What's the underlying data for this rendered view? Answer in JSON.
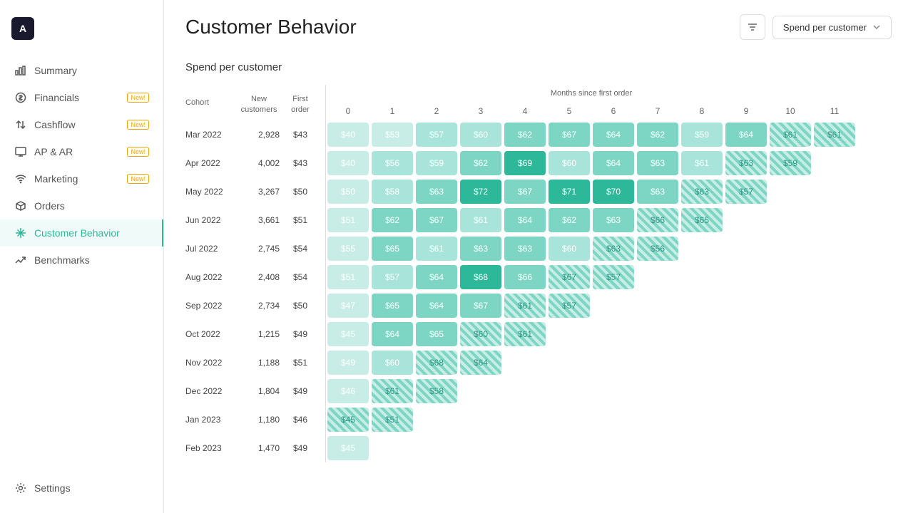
{
  "app": {
    "logo": "A"
  },
  "page": {
    "title": "Customer Behavior"
  },
  "header": {
    "dropdown_label": "Spend per customer",
    "section_title": "Spend per customer"
  },
  "sidebar": {
    "items": [
      {
        "id": "summary",
        "label": "Summary",
        "icon": "chart-bar",
        "badge": null,
        "active": false
      },
      {
        "id": "financials",
        "label": "Financials",
        "icon": "dollar-circle",
        "badge": "New!",
        "active": false
      },
      {
        "id": "cashflow",
        "label": "Cashflow",
        "icon": "arrows",
        "badge": "New!",
        "active": false
      },
      {
        "id": "ap-ar",
        "label": "AP & AR",
        "icon": "monitor",
        "badge": "New!",
        "active": false
      },
      {
        "id": "marketing",
        "label": "Marketing",
        "icon": "wifi",
        "badge": "New!",
        "active": false
      },
      {
        "id": "orders",
        "label": "Orders",
        "icon": "box",
        "badge": null,
        "active": false
      },
      {
        "id": "customer-behavior",
        "label": "Customer Behavior",
        "icon": "sparkle",
        "badge": null,
        "active": true
      },
      {
        "id": "benchmarks",
        "label": "Benchmarks",
        "icon": "trending",
        "badge": null,
        "active": false
      },
      {
        "id": "settings",
        "label": "Settings",
        "icon": "gear",
        "badge": null,
        "active": false
      }
    ]
  },
  "table": {
    "col_headers": [
      "Cohort",
      "New customers",
      "First order"
    ],
    "months_label": "Months since first order",
    "month_nums": [
      "0",
      "1",
      "2",
      "3",
      "4",
      "5",
      "6",
      "7",
      "8",
      "9",
      "10",
      "11"
    ],
    "rows": [
      {
        "cohort": "Mar 2022",
        "new": "2,928",
        "first": "$43",
        "cells": [
          "$40",
          "$53",
          "$57",
          "$60",
          "$62",
          "$67",
          "$64",
          "$62",
          "$59",
          "$64",
          "$61",
          "$61"
        ],
        "hatched": [
          10,
          11
        ]
      },
      {
        "cohort": "Apr 2022",
        "new": "4,002",
        "first": "$43",
        "cells": [
          "$40",
          "$56",
          "$59",
          "$62",
          "$69",
          "$60",
          "$64",
          "$63",
          "$61",
          "$63",
          "$59",
          ""
        ],
        "hatched": [
          9,
          10
        ]
      },
      {
        "cohort": "May 2022",
        "new": "3,267",
        "first": "$50",
        "cells": [
          "$50",
          "$58",
          "$63",
          "$72",
          "$67",
          "$71",
          "$70",
          "$63",
          "$63",
          "$57",
          "",
          ""
        ],
        "hatched": [
          8,
          9
        ]
      },
      {
        "cohort": "Jun 2022",
        "new": "3,661",
        "first": "$51",
        "cells": [
          "$51",
          "$62",
          "$67",
          "$61",
          "$64",
          "$62",
          "$63",
          "$66",
          "$65",
          "",
          "",
          ""
        ],
        "hatched": [
          7,
          8
        ]
      },
      {
        "cohort": "Jul 2022",
        "new": "2,745",
        "first": "$54",
        "cells": [
          "$55",
          "$65",
          "$61",
          "$63",
          "$63",
          "$60",
          "$63",
          "$56",
          "",
          "",
          "",
          ""
        ],
        "hatched": [
          6,
          7
        ]
      },
      {
        "cohort": "Aug 2022",
        "new": "2,408",
        "first": "$54",
        "cells": [
          "$51",
          "$57",
          "$64",
          "$68",
          "$66",
          "$67",
          "$57",
          "",
          "",
          "",
          "",
          ""
        ],
        "hatched": [
          5,
          6
        ]
      },
      {
        "cohort": "Sep 2022",
        "new": "2,734",
        "first": "$50",
        "cells": [
          "$47",
          "$65",
          "$64",
          "$67",
          "$61",
          "$57",
          "",
          "",
          "",
          "",
          "",
          ""
        ],
        "hatched": [
          4,
          5
        ]
      },
      {
        "cohort": "Oct 2022",
        "new": "1,215",
        "first": "$49",
        "cells": [
          "$45",
          "$64",
          "$65",
          "$60",
          "$61",
          "",
          "",
          "",
          "",
          "",
          "",
          ""
        ],
        "hatched": [
          3,
          4
        ]
      },
      {
        "cohort": "Nov 2022",
        "new": "1,188",
        "first": "$51",
        "cells": [
          "$49",
          "$60",
          "$68",
          "$64",
          "",
          "",
          "",
          "",
          "",
          "",
          "",
          ""
        ],
        "hatched": [
          2,
          3
        ]
      },
      {
        "cohort": "Dec 2022",
        "new": "1,804",
        "first": "$49",
        "cells": [
          "$46",
          "$61",
          "$58",
          "",
          "",
          "",
          "",
          "",
          "",
          "",
          "",
          ""
        ],
        "hatched": [
          1,
          2
        ]
      },
      {
        "cohort": "Jan 2023",
        "new": "1,180",
        "first": "$46",
        "cells": [
          "$45",
          "$51",
          "",
          "",
          "",
          "",
          "",
          "",
          "",
          "",
          "",
          ""
        ],
        "hatched": [
          0,
          1
        ]
      },
      {
        "cohort": "Feb 2023",
        "new": "1,470",
        "first": "$49",
        "cells": [
          "$45",
          "",
          "",
          "",
          "",
          "",
          "",
          "",
          "",
          "",
          "",
          ""
        ],
        "hatched": []
      }
    ]
  }
}
